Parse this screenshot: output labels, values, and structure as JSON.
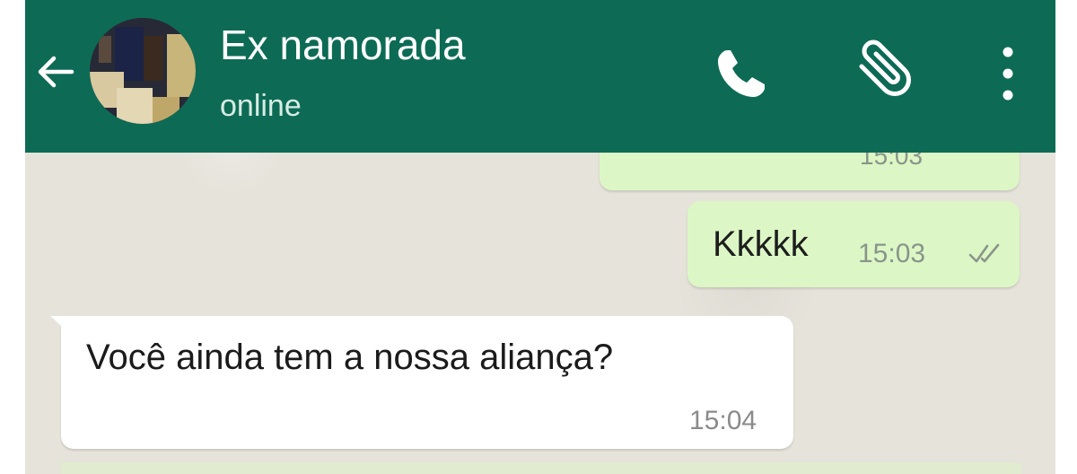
{
  "header": {
    "contact_name": "Ex namorada",
    "status": "online",
    "background_color": "#0d6b55"
  },
  "icons": {
    "back": "arrow-left-icon",
    "avatar": "contact-avatar",
    "call": "phone-icon",
    "attach": "paperclip-icon",
    "menu": "more-vertical-icon"
  },
  "messages": [
    {
      "direction": "outgoing",
      "time": "15:03",
      "status": "delivered"
    },
    {
      "direction": "outgoing",
      "text": "Kkkkk",
      "time": "15:03",
      "status": "delivered"
    },
    {
      "direction": "incoming",
      "text": "Você ainda tem a nossa aliança?",
      "time": "15:04"
    }
  ],
  "colors": {
    "outgoing_bubble": "#dcf7c5",
    "incoming_bubble": "#ffffff",
    "chat_background": "#e5e3da"
  }
}
